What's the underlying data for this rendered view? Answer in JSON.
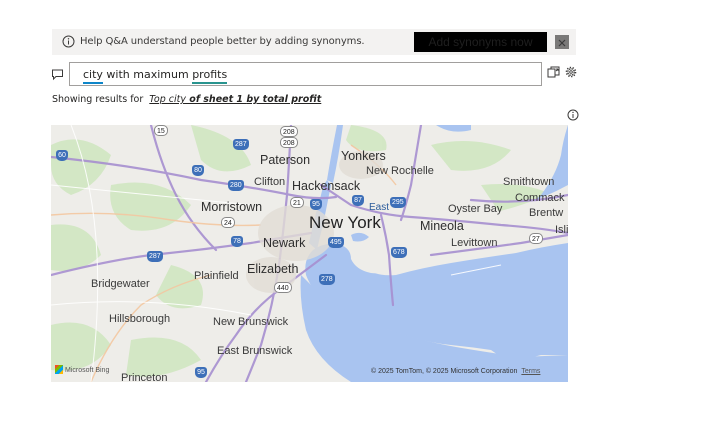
{
  "banner": {
    "message": "Help Q&A understand people better by adding synonyms.",
    "button_label": "Add synonyms now",
    "icon": "info-icon",
    "close_icon": "close-icon"
  },
  "query": {
    "text_part1": "city",
    "text_part2": " with maximum ",
    "text_part3": "profits",
    "icons": [
      "chat-icon",
      "copy-icon",
      "gear-icon"
    ]
  },
  "results": {
    "prefix": "Showing results for",
    "link_part1": "Top city",
    "link_part2": " of sheet 1 ",
    "link_part3": "by total profit"
  },
  "map": {
    "labels": {
      "new_york": "New York",
      "yonkers": "Yonkers",
      "paterson": "Paterson",
      "hackensack": "Hackensack",
      "clifton": "Clifton",
      "new_rochelle": "New Rochelle",
      "morristown": "Morristown",
      "newark": "Newark",
      "elizabeth": "Elizabeth",
      "plainfield": "Plainfield",
      "bridgewater": "Bridgewater",
      "hillsborough": "Hillsborough",
      "new_brunswick": "New Brunswick",
      "east_brunswick": "East Brunswick",
      "princeton": "Princeton",
      "mineola": "Mineola",
      "oyster_bay": "Oyster Bay",
      "levittown": "Levittown",
      "smithtown": "Smithtown",
      "commack": "Commack",
      "brentwood": "Brentw",
      "islip": "Isli",
      "east_river": "East"
    },
    "shields": [
      "15",
      "208",
      "208",
      "287",
      "80",
      "280",
      "21",
      "95",
      "87",
      "295",
      "24",
      "78",
      "287",
      "440",
      "278",
      "678",
      "495",
      "27",
      "95",
      "60"
    ],
    "attribution": "Microsoft Bing",
    "copyright": "© 2025 TomTom, © 2025 Microsoft Corporation",
    "terms": "Terms"
  },
  "colors": {
    "banner_bg": "#f3f2f1",
    "water": "#a9c4f0",
    "land": "#eeede9",
    "park": "#c9e4b8",
    "highway": "#a78fd0",
    "underline_blue": "#0e86c9",
    "underline_teal": "#29948f"
  }
}
